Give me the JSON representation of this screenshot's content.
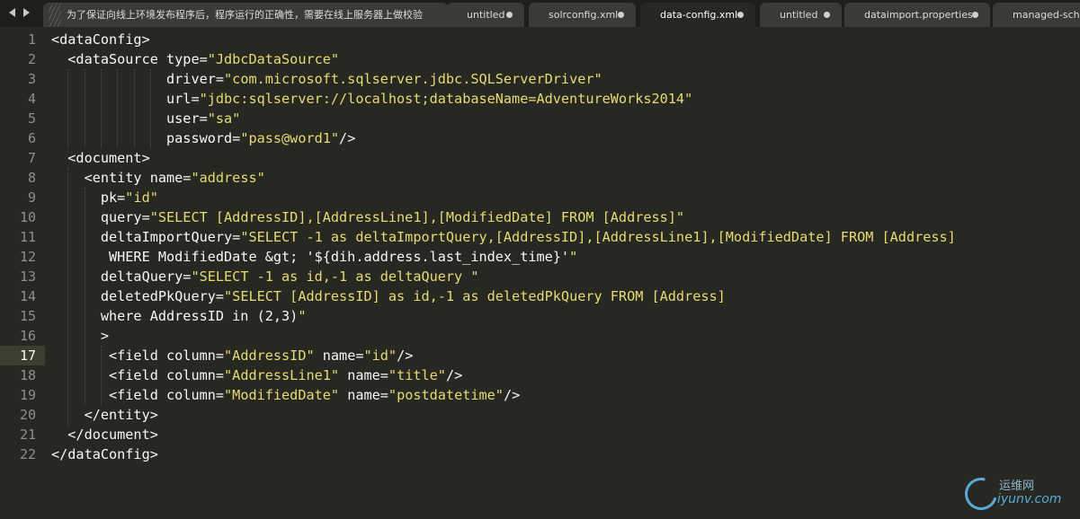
{
  "tabs": [
    {
      "label": "为了保证向线上环境发布程序后，程序运行的正确性，需要在线上服务器上做校验",
      "active": false,
      "dirty": false
    },
    {
      "label": "untitled",
      "active": false,
      "dirty": true
    },
    {
      "label": "solrconfig.xml",
      "active": false,
      "dirty": true
    },
    {
      "label": "data-config.xml",
      "active": true,
      "dirty": true
    },
    {
      "label": "untitled",
      "active": false,
      "dirty": true
    },
    {
      "label": "dataimport.properties",
      "active": false,
      "dirty": true
    },
    {
      "label": "managed-schema",
      "active": false,
      "dirty": false
    }
  ],
  "editor": {
    "current_line": 17,
    "lines": [
      {
        "n": "1",
        "text": "<dataConfig>"
      },
      {
        "n": "2",
        "text": "  <dataSource type=\"JdbcDataSource\""
      },
      {
        "n": "3",
        "text": "              driver=\"com.microsoft.sqlserver.jdbc.SQLServerDriver\""
      },
      {
        "n": "4",
        "text": "              url=\"jdbc:sqlserver://localhost;databaseName=AdventureWorks2014\""
      },
      {
        "n": "5",
        "text": "              user=\"sa\""
      },
      {
        "n": "6",
        "text": "              password=\"pass@word1\"/>"
      },
      {
        "n": "7",
        "text": "  <document>"
      },
      {
        "n": "8",
        "text": "    <entity name=\"address\""
      },
      {
        "n": "9",
        "text": "      pk=\"id\""
      },
      {
        "n": "10",
        "text": "      query=\"SELECT [AddressID],[AddressLine1],[ModifiedDate] FROM [Address]\""
      },
      {
        "n": "11",
        "text": "      deltaImportQuery=\"SELECT -1 as deltaImportQuery,[AddressID],[AddressLine1],[ModifiedDate] FROM [Address]"
      },
      {
        "n": "12",
        "text": "       WHERE ModifiedDate &gt; '${dih.address.last_index_time}'\""
      },
      {
        "n": "13",
        "text": "      deltaQuery=\"SELECT -1 as id,-1 as deltaQuery \""
      },
      {
        "n": "14",
        "text": "      deletedPkQuery=\"SELECT [AddressID] as id,-1 as deletedPkQuery FROM [Address]"
      },
      {
        "n": "15",
        "text": "      where AddressID in (2,3)\""
      },
      {
        "n": "16",
        "text": "      >"
      },
      {
        "n": "17",
        "text": "       <field column=\"AddressID\" name=\"id\"/>"
      },
      {
        "n": "18",
        "text": "       <field column=\"AddressLine1\" name=\"title\"/>"
      },
      {
        "n": "19",
        "text": "       <field column=\"ModifiedDate\" name=\"postdatetime\"/>"
      },
      {
        "n": "20",
        "text": "    </entity>"
      },
      {
        "n": "21",
        "text": "  </document>"
      },
      {
        "n": "22",
        "text": "</dataConfig>"
      }
    ]
  },
  "watermark": {
    "line1": "运维网",
    "line2": "iyunv.com"
  },
  "colors": {
    "background": "#272822",
    "string": "#e6db74",
    "text": "#f8f8f2",
    "gutter": "#8f908a"
  }
}
